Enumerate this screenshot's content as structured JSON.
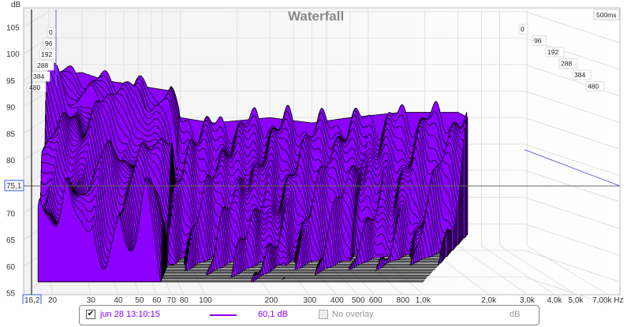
{
  "chart_data": {
    "type": "waterfall",
    "title": "Waterfall",
    "ylabel": "dB",
    "xlabel": "Hz",
    "ylim": [
      55,
      107
    ],
    "y_ticks": [
      "105",
      "100",
      "95",
      "90",
      "85",
      "80",
      "75,1",
      "70",
      "65",
      "60",
      "55"
    ],
    "y_tick_values": [
      105,
      100,
      95,
      90,
      85,
      80,
      75.1,
      70,
      65,
      60,
      55
    ],
    "cursor_db": "75,1",
    "cursor_hz": "16,2",
    "x_ticks": [
      "16,2",
      "20",
      "30",
      "40",
      "50",
      "60",
      "70",
      "80",
      "100",
      "200",
      "300",
      "400",
      "500",
      "600",
      "800",
      "1,0k",
      "2,0k",
      "3,0k",
      "4,0k",
      "5,0k",
      "7,00k Hz"
    ],
    "x_tick_values": [
      16.2,
      20,
      30,
      40,
      50,
      60,
      70,
      80,
      100,
      200,
      300,
      400,
      500,
      600,
      800,
      1000,
      2000,
      3000,
      4000,
      5000,
      7000
    ],
    "time_ticks_ms": [
      "0",
      "96",
      "192",
      "288",
      "384",
      "480"
    ],
    "time_range_label": "500ms",
    "series_color": "#8b00ff",
    "initial_response_db": [
      [
        20,
        93
      ],
      [
        30,
        93.5
      ],
      [
        40,
        92
      ],
      [
        60,
        91
      ],
      [
        90,
        90
      ],
      [
        100,
        85
      ],
      [
        150,
        84
      ],
      [
        300,
        85
      ],
      [
        500,
        84
      ],
      [
        800,
        85
      ],
      [
        1500,
        86
      ],
      [
        3000,
        86
      ],
      [
        3400,
        85
      ]
    ],
    "floor_db": 63
  },
  "legend": {
    "measurement": "jun 28 13:10:15",
    "value": "60,1 dB",
    "overlay": "No overlay",
    "overlay_unit": "dB"
  }
}
